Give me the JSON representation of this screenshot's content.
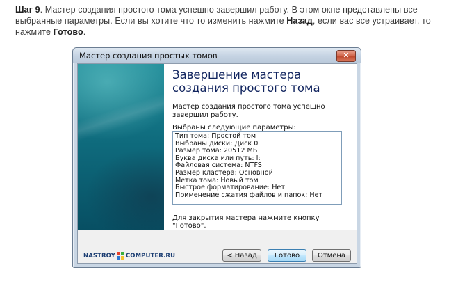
{
  "article": {
    "step_label": "Шаг 9",
    "text_1": ". Мастер создания простого тома успешно завершил работу. В этом окне представлены все выбранные параметры. Если вы хотите что то изменить нажмите ",
    "back_word": "Назад",
    "text_2": ", если вас все устраивает, то нажмите ",
    "done_word": "Готово",
    "text_3": "."
  },
  "window": {
    "title": "Мастер создания простых томов",
    "close_glyph": "✕"
  },
  "wizard": {
    "heading": "Завершение мастера создания простого тома",
    "description": "Мастер создания простого тома успешно завершил работу.",
    "params_label": "Выбраны следующие параметры:",
    "params": [
      "Тип тома: Простой том",
      "Выбраны диски: Диск 0",
      "Размер тома: 20512 МБ",
      "Буква диска или путь: I:",
      "Файловая система: NTFS",
      "Размер кластера: Основной",
      "Метка тома: Новый том",
      "Быстрое форматирование: Нет",
      "Применение сжатия файлов и папок: Нет"
    ],
    "finish_note": "Для закрытия мастера нажмите кнопку \"Готово\"."
  },
  "logo": {
    "left": "NASTROY",
    "right": "COMPUTER.RU",
    "colors": [
      "#e8402a",
      "#3cae3c",
      "#2e77d0",
      "#f2c12e"
    ]
  },
  "buttons": {
    "back": "< Назад",
    "finish": "Готово",
    "cancel": "Отмена"
  }
}
